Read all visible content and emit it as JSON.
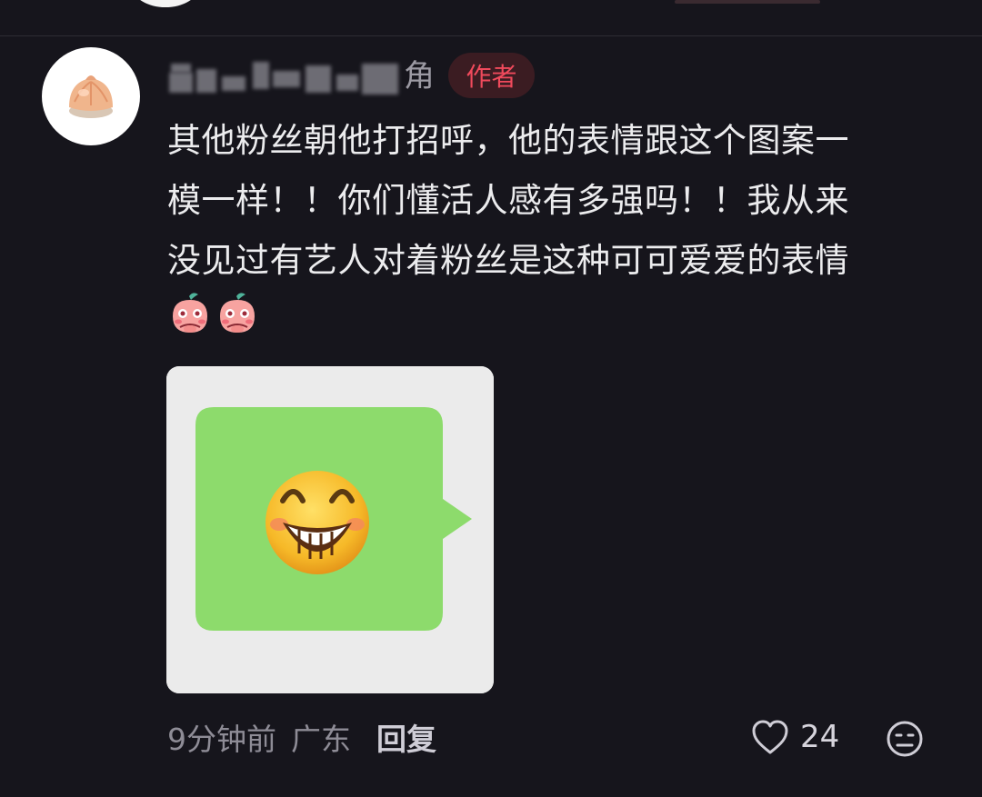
{
  "comment": {
    "username_suffix": "角",
    "author_badge": "作者",
    "text": "其他粉丝朝他打招呼，他的表情跟这个图案一\n模一样！！你们懂活人感有多强吗！！我从来\n没见过有艺人对着粉丝是这种可可爱爱的表情",
    "stickers": [
      "peach-blush-sticker",
      "peach-blush-sticker"
    ],
    "attached_image": {
      "description_icon": "grinning-face-emoji",
      "bubble_color": "#8ddb6c"
    },
    "time": "9分钟前",
    "location": "广东",
    "reply_label": "回复",
    "like_count": "24"
  },
  "colors": {
    "background": "#16151c",
    "badge_text": "#f04a5c",
    "badge_bg": "#3b1c22"
  }
}
